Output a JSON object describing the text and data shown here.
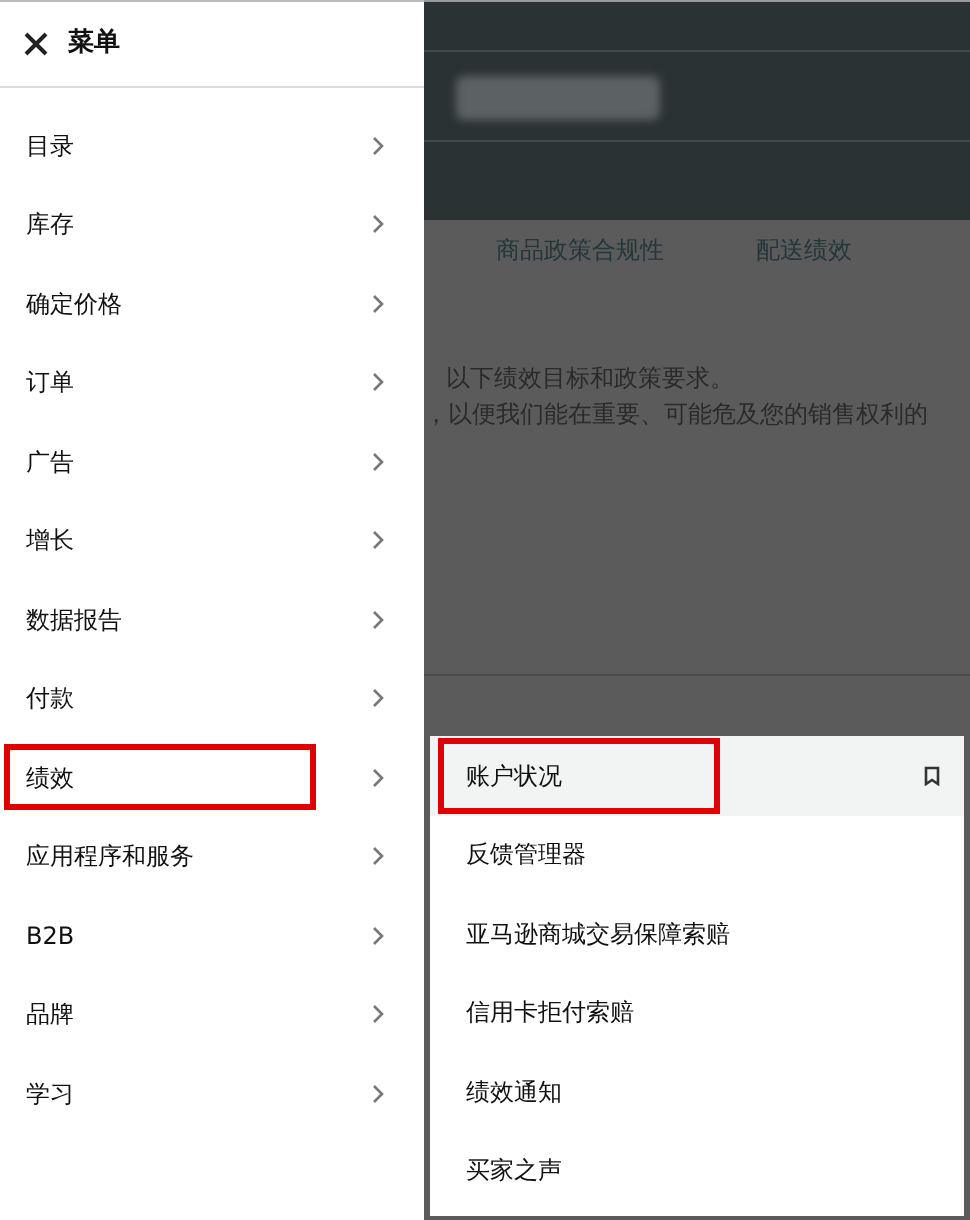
{
  "menu": {
    "title": "菜单",
    "items": [
      {
        "label": "目录",
        "annotated": false
      },
      {
        "label": "库存",
        "annotated": false
      },
      {
        "label": "确定价格",
        "annotated": false
      },
      {
        "label": "订单",
        "annotated": false
      },
      {
        "label": "广告",
        "annotated": false
      },
      {
        "label": "增长",
        "annotated": false
      },
      {
        "label": "数据报告",
        "annotated": false
      },
      {
        "label": "付款",
        "annotated": false
      },
      {
        "label": "绩效",
        "annotated": true
      },
      {
        "label": "应用程序和服务",
        "annotated": false
      },
      {
        "label": "B2B",
        "annotated": false
      },
      {
        "label": "品牌",
        "annotated": false
      },
      {
        "label": "学习",
        "annotated": false
      }
    ]
  },
  "submenu": {
    "items": [
      {
        "label": "账户状况",
        "selected": true,
        "annotated": true,
        "bookmark": true
      },
      {
        "label": "反馈管理器",
        "selected": false,
        "annotated": false,
        "bookmark": false
      },
      {
        "label": "亚马逊商城交易保障索赔",
        "selected": false,
        "annotated": false,
        "bookmark": false
      },
      {
        "label": "信用卡拒付索赔",
        "selected": false,
        "annotated": false,
        "bookmark": false
      },
      {
        "label": "绩效通知",
        "selected": false,
        "annotated": false,
        "bookmark": false
      },
      {
        "label": "买家之声",
        "selected": false,
        "annotated": false,
        "bookmark": false
      }
    ]
  },
  "page": {
    "tabs": [
      "商品政策合规性",
      "配送绩效"
    ],
    "lines": [
      "以下绩效目标和政策要求。",
      "，以便我们能在重要、可能危及您的销售权利的"
    ]
  }
}
